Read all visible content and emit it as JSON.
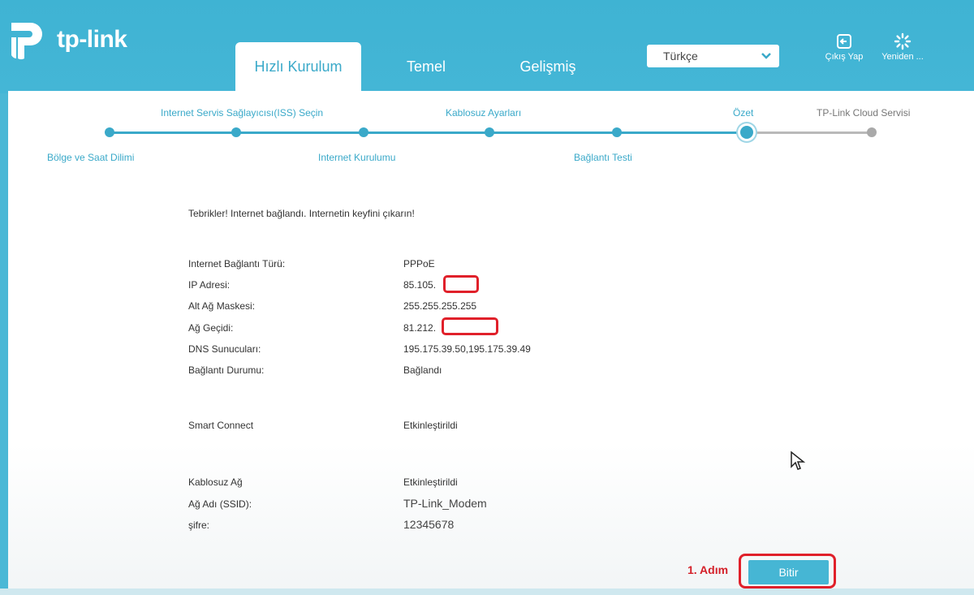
{
  "brand": {
    "name": "tp-link"
  },
  "nav": {
    "tabs": [
      {
        "label": "Hızlı Kurulum",
        "active": true
      },
      {
        "label": "Temel",
        "active": false
      },
      {
        "label": "Gelişmiş",
        "active": false
      }
    ],
    "language": "Türkçe",
    "logout_label": "Çıkış Yap",
    "reboot_label": "Yeniden ..."
  },
  "colors": {
    "accent": "#3aa9c9",
    "header": "#44b6d6",
    "annotation": "#e0202a"
  },
  "wizard": {
    "steps": [
      {
        "label": "Bölge ve Saat Dilimi",
        "state": "done"
      },
      {
        "label": "Internet Servis Sağlayıcısı(ISS) Seçin",
        "state": "done"
      },
      {
        "label": "Internet Kurulumu",
        "state": "done"
      },
      {
        "label": "Kablosuz Ayarları",
        "state": "done"
      },
      {
        "label": "Bağlantı Testi",
        "state": "done"
      },
      {
        "label": "Özet",
        "state": "current"
      },
      {
        "label": "TP-Link Cloud Servisi",
        "state": "pending"
      }
    ]
  },
  "summary": {
    "message": "Tebrikler! Internet bağlandı. Internetin keyfini çıkarın!",
    "rows": [
      {
        "label": "Internet Bağlantı Türü:",
        "value": "PPPoE"
      },
      {
        "label": "IP Adresi:",
        "value": "85.105."
      },
      {
        "label": "Alt Ağ Maskesi:",
        "value": "255.255.255.255"
      },
      {
        "label": "Ağ Geçidi:",
        "value": "81.212."
      },
      {
        "label": "DNS Sunucuları:",
        "value": "195.175.39.50,195.175.39.49"
      },
      {
        "label": "Bağlantı Durumu:",
        "value": "Bağlandı"
      },
      {
        "label": "Smart Connect",
        "value": "Etkinleştirildi"
      },
      {
        "label": "Kablosuz Ağ",
        "value": "Etkinleştirildi"
      },
      {
        "label": "Ağ Adı (SSID):",
        "value": "TP-Link_Modem"
      },
      {
        "label": "şifre:",
        "value": "12345678"
      }
    ]
  },
  "annotation": {
    "label": "1. Adım"
  },
  "actions": {
    "finish_label": "Bitir"
  }
}
